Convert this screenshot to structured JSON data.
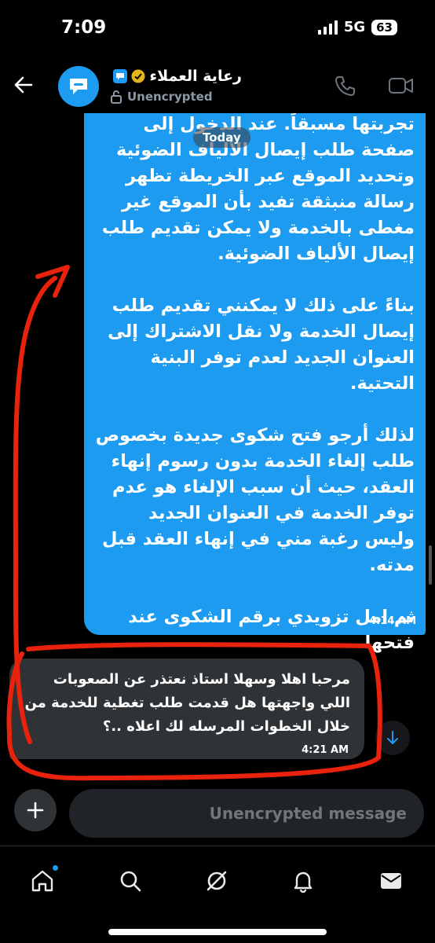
{
  "status_bar": {
    "time": "7:09",
    "network": "5G",
    "battery": "63"
  },
  "header": {
    "title": "رعاية العملاء",
    "subtitle": "Unencrypted"
  },
  "date_separator": "Today",
  "messages": [
    {
      "direction": "outgoing",
      "text": "تجربتها مسبقاً. عند الدخول إلى صفحة طلب إيصال الألياف الضوئية وتحديد الموقع عبر الخريطة تظهر رسالة منبثقة تفيد بأن الموقع غير مغطى بالخدمة ولا يمكن تقديم طلب إيصال الألياف الضوئية.\n\nبناءً على ذلك لا يمكنني تقديم طلب إيصال الخدمة ولا نقل الاشتراك إلى العنوان الجديد لعدم توفر البنية التحتية.\n\nلذلك أرجو فتح شكوى جديدة بخصوص طلب إلغاء الخدمة بدون رسوم إنهاء العقد، حيث أن سبب الإلغاء هو عدم توفر الخدمة في العنوان الجديد وليس رغبة مني في إنهاء العقد قبل مدته.\n\nثم امل تزويدي برقم الشكوى عند فتحها",
      "time": "4:14 AM"
    },
    {
      "direction": "incoming",
      "text": "مرحبا اهلا وسهلا استاذ نعتذر عن الصعوبات اللي واجهتها هل قدمت طلب تغطية للخدمة من خلال الخطوات المرسله لك اعلاه ..؟",
      "time": "4:21 AM"
    }
  ],
  "composer": {
    "placeholder": "Unencrypted message"
  },
  "tabbar": [
    "home-icon",
    "search-icon",
    "grok-icon",
    "notifications-icon",
    "messages-icon"
  ],
  "colors": {
    "accent": "#1d9bf0",
    "annotation": "#e8220c",
    "incoming_bubble": "#2f3336",
    "background": "#000000"
  }
}
